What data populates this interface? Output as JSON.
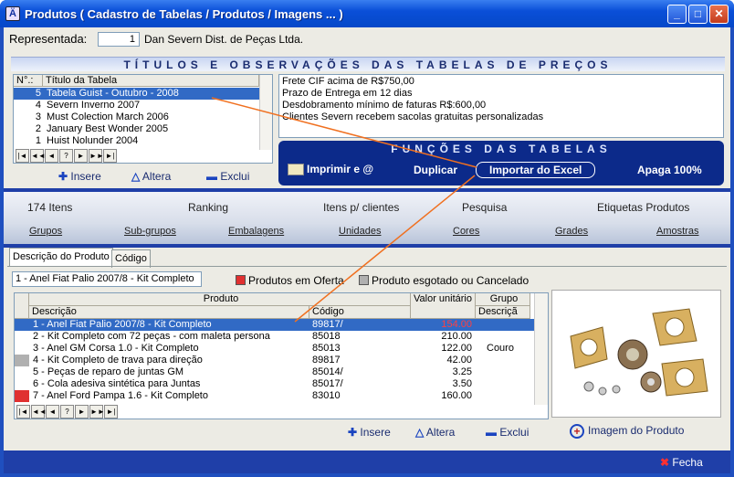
{
  "window": {
    "title": "Produtos ( Cadastro de Tabelas / Produtos / Imagens ... )",
    "icon": "app-icon"
  },
  "representada": {
    "label": "Representada:",
    "code": "1",
    "name": "Dan Severn Dist. de Peças Ltda."
  },
  "tabelas": {
    "header": "TÍTULOS E OBSERVAÇÕES DAS TABELAS DE PREÇOS",
    "col_num": "N°.:",
    "col_title": "Título da Tabela",
    "rows": [
      {
        "num": "5",
        "title": "Tabela Guist - Outubro - 2008"
      },
      {
        "num": "4",
        "title": "Severn Inverno 2007"
      },
      {
        "num": "3",
        "title": "Must Colection March 2006"
      },
      {
        "num": "2",
        "title": "January Best Wonder 2005"
      },
      {
        "num": "1",
        "title": "Huist Nolunder 2004"
      }
    ],
    "nav": [
      "|◄",
      "◄◄",
      "◄",
      "?",
      "►",
      "►►",
      "►|"
    ],
    "insere": "Insere",
    "altera": "Altera",
    "exclui": "Exclui"
  },
  "observacoes": [
    "Frete CIF acima de R$750,00",
    "Prazo de Entrega em 12 dias",
    "Desdobramento mínimo de faturas R$:600,00",
    "Clientes Severn recebem sacolas gratuitas personalizadas"
  ],
  "funcoes": {
    "title": "FUNÇÕES DAS TABELAS",
    "imprimir": "Imprimir e @",
    "duplicar": "Duplicar",
    "importar": "Importar do Excel",
    "apaga": "Apaga 100%"
  },
  "middle": {
    "row1": [
      "174 Itens",
      "Ranking",
      "Itens p/ clientes",
      "Pesquisa",
      "Etiquetas Produtos"
    ],
    "row2": [
      "Grupos",
      "Sub-grupos",
      "Embalagens",
      "Unidades",
      "Cores",
      "Grades",
      "Amostras"
    ]
  },
  "produtos": {
    "tabs": [
      "Descrição do Produto",
      "Código"
    ],
    "search_value": "1 - Anel Fiat Palio 2007/8 - Kit Completo",
    "oferta": "Produtos em Oferta",
    "esgotado": "Produto esgotado ou Cancelado",
    "col_produto": "Produto",
    "col_descricao": "Descrição",
    "col_codigo": "Código",
    "col_valor": "Valor unitário",
    "col_grupo": "Grupo",
    "col_grupo_desc": "Descriçã",
    "rows": [
      {
        "desc": "1 - Anel Fiat Palio 2007/8 - Kit Completo",
        "codigo": "89817/",
        "valor": "154.00",
        "grupo": "",
        "marker": "none"
      },
      {
        "desc": "2 - Kit Completo com 72 peças - com maleta persona",
        "codigo": "85018",
        "valor": "210.00",
        "grupo": "",
        "marker": "none"
      },
      {
        "desc": "3 - Anel GM Corsa 1.0 - Kit Completo",
        "codigo": "85013",
        "valor": "122.00",
        "grupo": "Couro",
        "marker": "none"
      },
      {
        "desc": "4 - Kit Completo de trava para direção",
        "codigo": "89817",
        "valor": "42.00",
        "grupo": "",
        "marker": "gray"
      },
      {
        "desc": "5 - Peças de reparo de juntas GM",
        "codigo": "85014/",
        "valor": "3.25",
        "grupo": "",
        "marker": "none"
      },
      {
        "desc": "6 - Cola adesiva sintética para Juntas",
        "codigo": "85017/",
        "valor": "3.50",
        "grupo": "",
        "marker": "none"
      },
      {
        "desc": "7 - Anel Ford Pampa 1.6 - Kit Completo",
        "codigo": "83010",
        "valor": "160.00",
        "grupo": "",
        "marker": "red"
      }
    ],
    "insere": "Insere",
    "altera": "Altera",
    "exclui": "Exclui",
    "imagem": "Imagem do Produto"
  },
  "fecha": "Fecha",
  "colors": {
    "selection": "#316ac5",
    "panel": "#0c2a8a",
    "oferta": "#e03030",
    "esgotado": "#b0b0b0"
  }
}
